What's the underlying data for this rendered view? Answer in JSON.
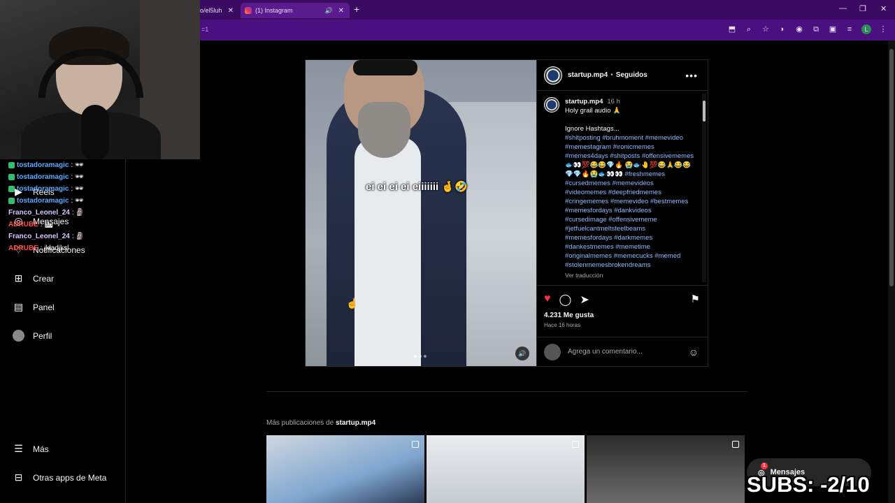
{
  "browser": {
    "tabs": [
      {
        "label": "o/el5luh",
        "close": "✕"
      },
      {
        "label": "(1) Instagram",
        "close": "✕",
        "audio": "🔊"
      }
    ],
    "new_tab": "+",
    "url_fragment": "=1",
    "window_controls": [
      "—",
      "❐",
      "✕"
    ],
    "profile_letter": "L"
  },
  "stream_chat": [
    {
      "user": "tostadoramagic",
      "msg": ": 🕶"
    },
    {
      "user": "tostadoramagic",
      "msg": ": 🕶"
    },
    {
      "user": "tostadoramagic",
      "msg": ": 🕶"
    },
    {
      "user": "tostadoramagic",
      "msg": ": 🕶"
    },
    {
      "user": "Franco_Leonel_24",
      "msg": ": 🗿"
    },
    {
      "user": "ADRUBE",
      "msg": ": 🏙"
    },
    {
      "user": "Franco_Leonel_24",
      "msg": ": 🗿"
    },
    {
      "user": "ADRUBE",
      "msg": ": jkladjksl"
    }
  ],
  "sidebar": {
    "items": [
      {
        "label": "Reels",
        "icon": "reels-icon"
      },
      {
        "label": "Mensajes",
        "icon": "messenger-icon"
      },
      {
        "label": "Notificaciones",
        "icon": "heart-icon"
      },
      {
        "label": "Crear",
        "icon": "plus-square-icon"
      },
      {
        "label": "Panel",
        "icon": "chart-icon"
      },
      {
        "label": "Perfil",
        "icon": "avatar-icon"
      },
      {
        "label": "Más",
        "icon": "menu-icon"
      },
      {
        "label": "Otras apps de Meta",
        "icon": "meta-apps-icon"
      }
    ]
  },
  "post": {
    "video_caption": "ei ei ei ei eiiiiiii 🤞🤣",
    "header": {
      "username": "startup.mp4",
      "separator": "•",
      "follow_state": "Seguidos",
      "more": "•••"
    },
    "description": {
      "username": "startup.mp4",
      "time": "16 h",
      "line1": "Holy grail audio 🙏",
      "line2": "Ignore Hashtags...",
      "hashtags": "#shitposting #bruhmoment #memevideo #memestagram #ironicmemes #memes4days #shitposts #offensivememes 🐟👀💯😂😂💎🔥 😭🐟🤚💯😂🙏😂😂💎💎🔥😭🐟👀👀 #freshmemes #cursedmemes #memevideos #videomemes #deepfriedmemes #cringememes #memevideo #bestmemes #memesfordays #dankvideos #cursedimage #offensivememe #jetfuelcantmeltsteelbeams #memesfordays #darkmemes #dankestmemes #memetime #originalmemes #memecucks #memed #stolenmemesbrokendreams",
      "translate": "Ver traducción"
    },
    "likes": "4.231 Me gusta",
    "ago": "Hace 16 horas",
    "comment_placeholder": "Agrega un comentario..."
  },
  "more_posts": {
    "prefix": "Más publicaciones de",
    "username": "startup.mp4"
  },
  "messages_bar": {
    "label": "Mensajes",
    "badge": "1"
  },
  "overlay": {
    "subs": "SUBS: -2/10"
  }
}
